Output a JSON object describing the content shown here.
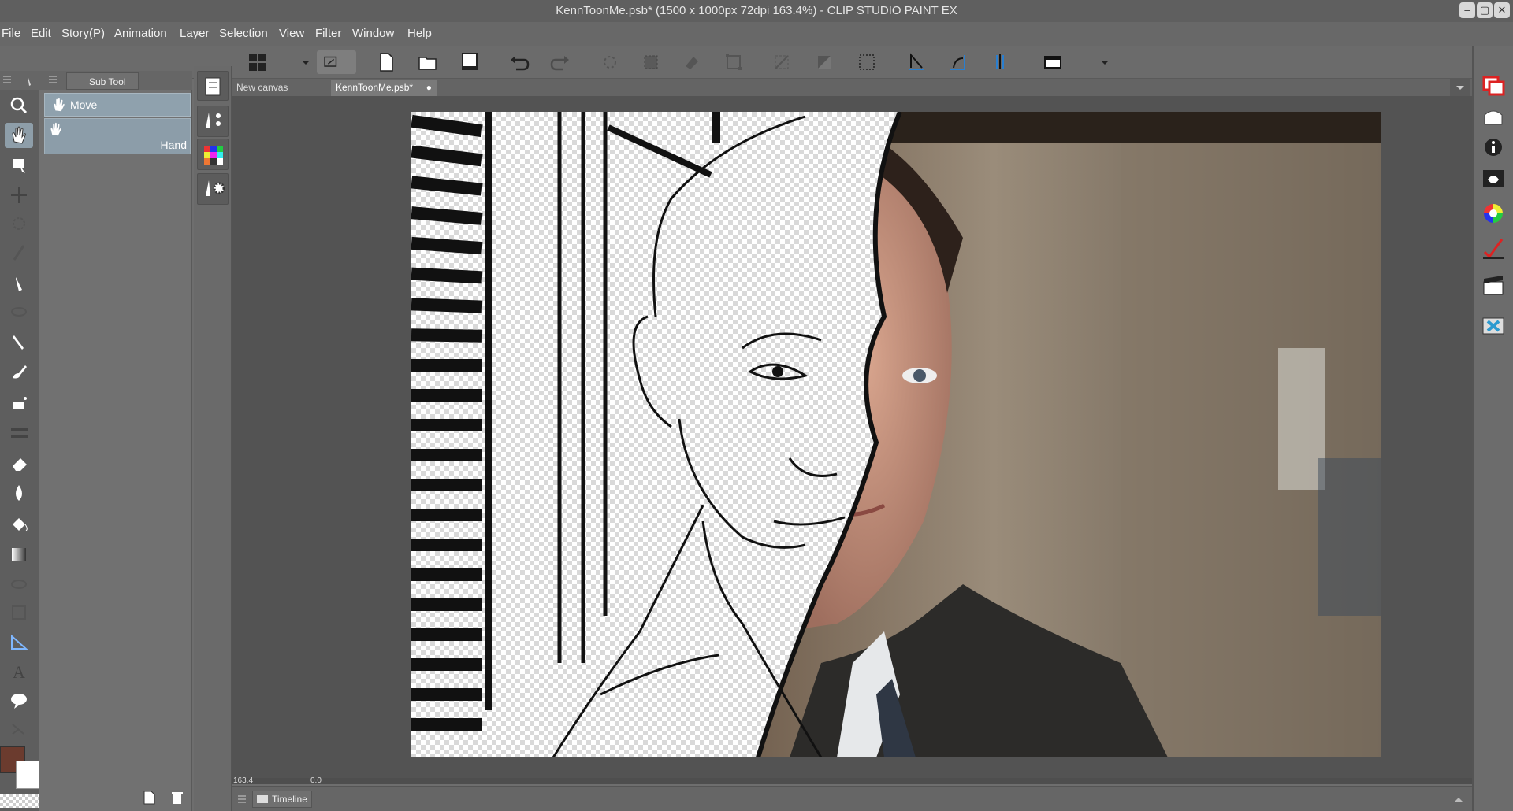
{
  "window": {
    "title": "KennToonMe.psb* (1500 x 1000px 72dpi 163.4%)  - CLIP STUDIO PAINT EX",
    "controls": [
      "minimize",
      "maximize",
      "close"
    ]
  },
  "menu": [
    "File",
    "Edit",
    "Story(P)",
    "Animation",
    "Layer",
    "Selection",
    "View",
    "Filter",
    "Window",
    "Help"
  ],
  "toolbar": {
    "icons": [
      "layout-icon",
      "dropdown-icon",
      "companion-mode-icon",
      "new-file-icon",
      "open-file-icon",
      "save-icon",
      "undo-icon",
      "redo-icon",
      "erase-selection-icon",
      "fill-selection-icon",
      "transform-icon",
      "scale-icon",
      "deselect-icon",
      "invert-selection-icon",
      "show-selection-area-icon",
      "snap-ruler-icon",
      "snap-special-ruler-icon",
      "snap-grid-icon",
      "canvas-icon",
      "more-icon"
    ]
  },
  "subtool_panel": {
    "tab_label": "Sub Tool",
    "group_label": "Move",
    "active_item_label": "Hand"
  },
  "document_tabs": [
    {
      "label": "New canvas",
      "active": false
    },
    {
      "label": "KennToonMe.psb*",
      "active": true
    }
  ],
  "status": {
    "zoom": "163.4",
    "angle": "0.0"
  },
  "timeline": {
    "label": "Timeline"
  },
  "colors": {
    "main": "#6b3b2e",
    "sub": "#ffffff",
    "accent_active": "#8fa1ad"
  }
}
